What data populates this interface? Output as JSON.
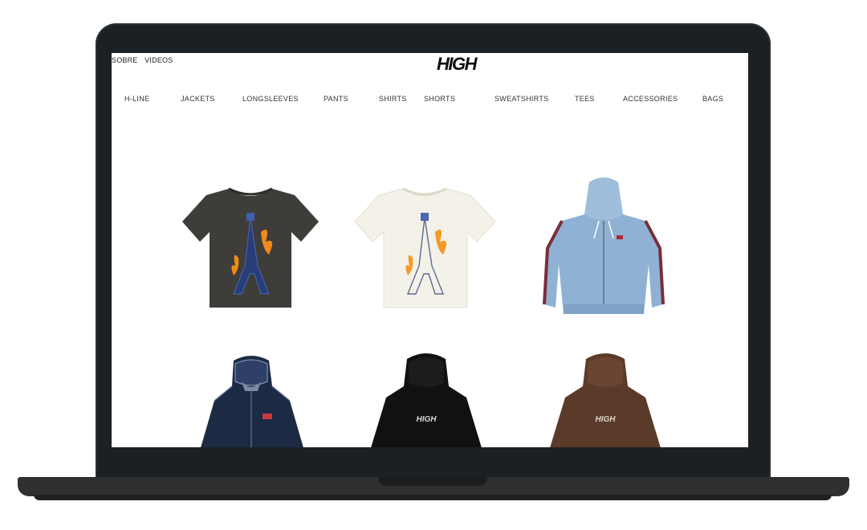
{
  "header": {
    "top_links": [
      "SOBRE",
      "VIDEOS"
    ],
    "logo_text": "HIGH"
  },
  "nav": {
    "items": [
      "H-LINE",
      "JACKETS",
      "LONGSLEEVES",
      "PANTS",
      "SHIRTS",
      "SHORTS",
      "SWEATSHIRTS",
      "TEES",
      "ACCESSORIES",
      "BAGS"
    ]
  },
  "products": [
    {
      "kind": "tee",
      "color": "#3f3d3a",
      "graphic": "eiffel-tower-flames"
    },
    {
      "kind": "tee",
      "color": "#f4f1e8",
      "graphic": "eiffel-tower-flames"
    },
    {
      "kind": "denim-zip-hoodie",
      "color": "#8fb1d3"
    },
    {
      "kind": "zip-hoodie",
      "color": "#1d2a44"
    },
    {
      "kind": "hoodie",
      "color": "#111111",
      "print": "HIGH"
    },
    {
      "kind": "hoodie",
      "color": "#5a3b2a",
      "print": "HIGH"
    }
  ],
  "colors": {
    "laptop_frame": "#1b2024",
    "laptop_base": "#2d2f31",
    "screen_bg": "#ffffff"
  }
}
